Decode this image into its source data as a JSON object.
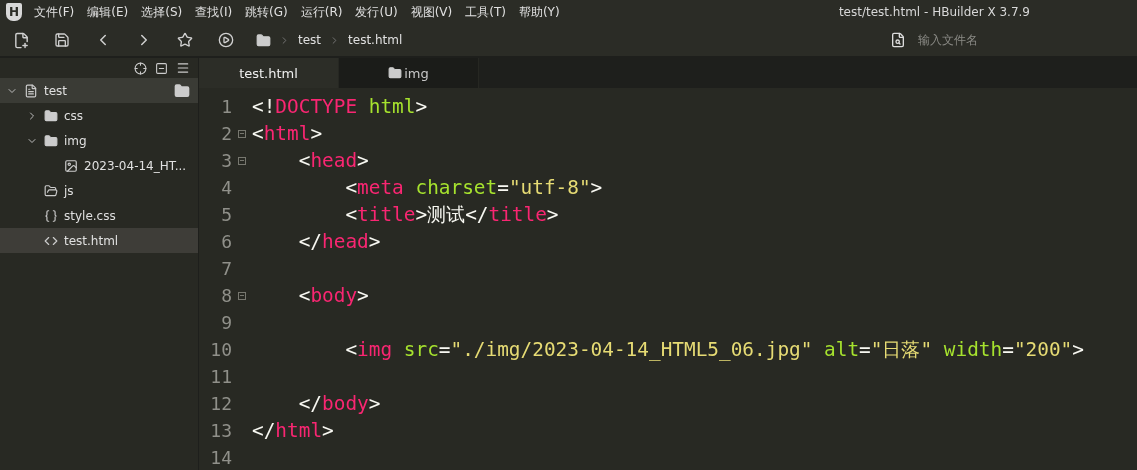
{
  "window": {
    "logo": "H",
    "title": "test/test.html - HBuilder X 3.7.9"
  },
  "menu": [
    "文件(F)",
    "编辑(E)",
    "选择(S)",
    "查找(I)",
    "跳转(G)",
    "运行(R)",
    "发行(U)",
    "视图(V)",
    "工具(T)",
    "帮助(Y)"
  ],
  "breadcrumb": [
    "test",
    "test.html"
  ],
  "file_search": {
    "placeholder": "输入文件名"
  },
  "sidebar": {
    "items": [
      {
        "label": "test",
        "kind": "project",
        "expanded": true,
        "selected": false,
        "children": [
          {
            "label": "css",
            "kind": "folder",
            "expanded": false,
            "selected": false
          },
          {
            "label": "img",
            "kind": "folder",
            "expanded": true,
            "selected": false,
            "children": [
              {
                "label": "2023-04-14_HT...",
                "kind": "image",
                "selected": false
              }
            ]
          },
          {
            "label": "js",
            "kind": "empty-folder",
            "selected": false
          },
          {
            "label": "style.css",
            "kind": "css",
            "selected": false
          },
          {
            "label": "test.html",
            "kind": "html",
            "selected": true
          }
        ]
      }
    ]
  },
  "tabs": [
    {
      "label": "test.html",
      "kind": "file",
      "selected": true
    },
    {
      "label": "img",
      "kind": "folder",
      "selected": false
    }
  ],
  "editor": {
    "lines": [
      {
        "number": "1",
        "fold": false,
        "tokens": [
          {
            "kind": "punct",
            "text": "<!"
          },
          {
            "kind": "tag",
            "text": "DOCTYPE "
          },
          {
            "kind": "attr",
            "text": "html"
          },
          {
            "kind": "punct",
            "text": ">"
          }
        ]
      },
      {
        "number": "2",
        "fold": true,
        "tokens": [
          {
            "kind": "punct",
            "text": "<"
          },
          {
            "kind": "tag",
            "text": "html"
          },
          {
            "kind": "punct",
            "text": ">"
          }
        ]
      },
      {
        "number": "3",
        "fold": true,
        "tokens": [
          {
            "kind": "punct",
            "text": "    <"
          },
          {
            "kind": "tag",
            "text": "head"
          },
          {
            "kind": "punct",
            "text": ">"
          }
        ]
      },
      {
        "number": "4",
        "fold": false,
        "tokens": [
          {
            "kind": "punct",
            "text": "        <"
          },
          {
            "kind": "tag",
            "text": "meta "
          },
          {
            "kind": "attr",
            "text": "charset"
          },
          {
            "kind": "punct",
            "text": "="
          },
          {
            "kind": "string",
            "text": "\"utf-8\""
          },
          {
            "kind": "punct",
            "text": ">"
          }
        ]
      },
      {
        "number": "5",
        "fold": false,
        "tokens": [
          {
            "kind": "punct",
            "text": "        <"
          },
          {
            "kind": "tag",
            "text": "title"
          },
          {
            "kind": "punct",
            "text": ">测试</"
          },
          {
            "kind": "tag",
            "text": "title"
          },
          {
            "kind": "punct",
            "text": ">"
          }
        ]
      },
      {
        "number": "6",
        "fold": false,
        "tokens": [
          {
            "kind": "punct",
            "text": "    </"
          },
          {
            "kind": "tag",
            "text": "head"
          },
          {
            "kind": "punct",
            "text": ">"
          }
        ]
      },
      {
        "number": "7",
        "fold": false
      },
      {
        "number": "8",
        "fold": true,
        "tokens": [
          {
            "kind": "punct",
            "text": "    <"
          },
          {
            "kind": "tag",
            "text": "body"
          },
          {
            "kind": "punct",
            "text": ">"
          }
        ]
      },
      {
        "number": "9",
        "fold": false
      },
      {
        "number": "10",
        "fold": false,
        "tokens": [
          {
            "kind": "punct",
            "text": "        <"
          },
          {
            "kind": "tag",
            "text": "img "
          },
          {
            "kind": "attr",
            "text": "src"
          },
          {
            "kind": "punct",
            "text": "="
          },
          {
            "kind": "string",
            "text": "\"./img/2023-04-14_HTML5_06.jpg\" "
          },
          {
            "kind": "attr",
            "text": "alt"
          },
          {
            "kind": "punct",
            "text": "="
          },
          {
            "kind": "string",
            "text": "\"日落\" "
          },
          {
            "kind": "attr",
            "text": "width"
          },
          {
            "kind": "punct",
            "text": "="
          },
          {
            "kind": "string",
            "text": "\"200\""
          },
          {
            "kind": "punct",
            "text": ">"
          }
        ]
      },
      {
        "number": "11",
        "fold": false
      },
      {
        "number": "12",
        "fold": false,
        "tokens": [
          {
            "kind": "punct",
            "text": "    </"
          },
          {
            "kind": "tag",
            "text": "body"
          },
          {
            "kind": "punct",
            "text": ">"
          }
        ]
      },
      {
        "number": "13",
        "fold": false,
        "tokens": [
          {
            "kind": "punct",
            "text": "</"
          },
          {
            "kind": "tag",
            "text": "html"
          },
          {
            "kind": "punct",
            "text": ">"
          }
        ]
      },
      {
        "number": "14",
        "fold": false
      }
    ]
  }
}
